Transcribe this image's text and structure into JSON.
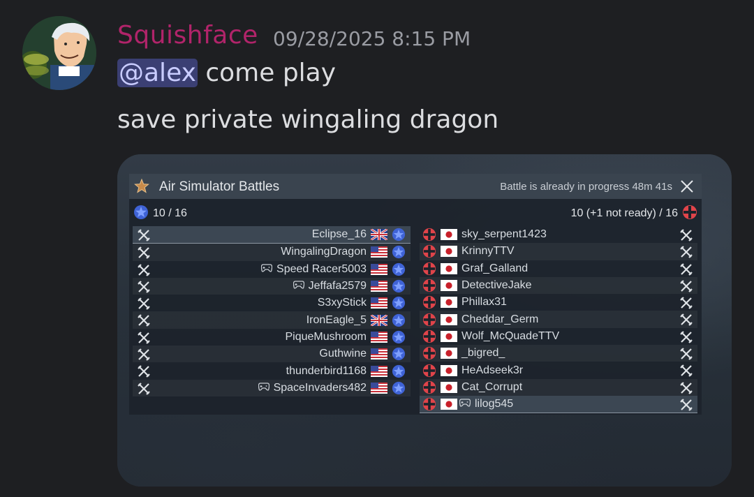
{
  "message": {
    "author": "Squishface",
    "timestamp": "09/28/2025 8:15 PM",
    "mention": "@alex",
    "line1_rest": " come play",
    "line2": "save private wingaling dragon",
    "author_color": "#b1246a"
  },
  "battle_window": {
    "title": "Air Simulator Battles",
    "status": "Battle is already in progress 48m 41s",
    "left_team": {
      "count": "10 / 16",
      "country_icon": "usa-star-roundel",
      "players": [
        {
          "name": "Eclipse_16",
          "flag": "uk",
          "console": false,
          "highlighted": true
        },
        {
          "name": "WingalingDragon",
          "flag": "us",
          "console": false
        },
        {
          "name": "Speed Racer5003",
          "flag": "us",
          "console": true
        },
        {
          "name": "Jeffafa2579",
          "flag": "us",
          "console": true
        },
        {
          "name": "S3xyStick",
          "flag": "us",
          "console": false
        },
        {
          "name": "IronEagle_5",
          "flag": "uk",
          "console": false
        },
        {
          "name": "PiqueMushroom",
          "flag": "us",
          "console": false
        },
        {
          "name": "Guthwine",
          "flag": "us",
          "console": false
        },
        {
          "name": "thunderbird1168",
          "flag": "us",
          "console": false
        },
        {
          "name": "SpaceInvaders482",
          "flag": "us",
          "console": true
        }
      ]
    },
    "right_team": {
      "count": "10 (+1 not ready) / 16",
      "country_icon": "enemy-cross-roundel",
      "players": [
        {
          "name": "sky_serpent1423",
          "flag": "jp",
          "console": false
        },
        {
          "name": "KrinnyTTV",
          "flag": "jp",
          "console": false
        },
        {
          "name": "Graf_Galland",
          "flag": "jp",
          "console": false
        },
        {
          "name": "DetectiveJake",
          "flag": "jp",
          "console": false
        },
        {
          "name": "Phillax31",
          "flag": "jp",
          "console": false
        },
        {
          "name": "Cheddar_Germ",
          "flag": "jp",
          "console": false
        },
        {
          "name": "Wolf_McQuadeTTV",
          "flag": "jp",
          "console": false
        },
        {
          "name": "_bigred_",
          "flag": "jp",
          "console": false
        },
        {
          "name": "HeAdseek3r",
          "flag": "jp",
          "console": false
        },
        {
          "name": "Cat_Corrupt",
          "flag": "jp",
          "console": false
        },
        {
          "name": "lilog545",
          "flag": "jp",
          "console": true,
          "highlighted": true
        }
      ]
    }
  }
}
